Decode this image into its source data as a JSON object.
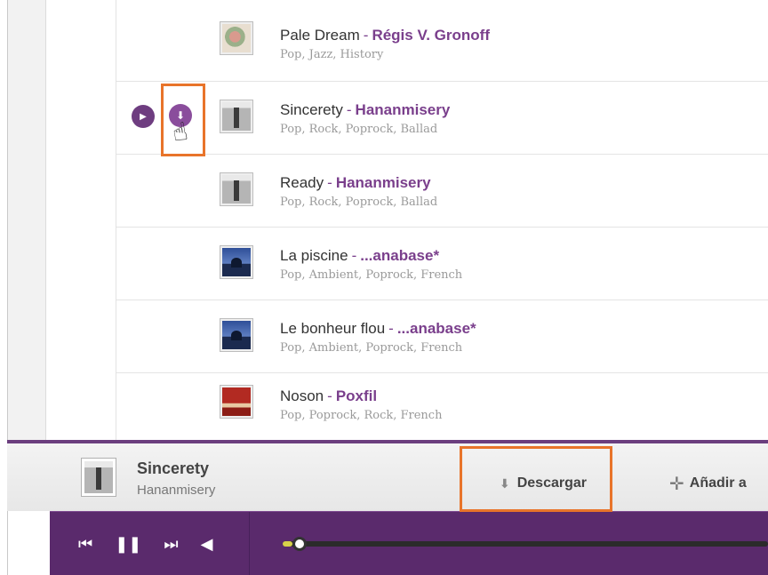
{
  "tracks": [
    {
      "title": "Pale Dream",
      "sep": "-",
      "artist": "Régis V. Gronoff",
      "tags": "Pop, Jazz, History",
      "cover_icon": "flower-cover"
    },
    {
      "title": "Sincerety",
      "sep": "-",
      "artist": "Hananmisery",
      "tags": "Pop, Rock, Poprock, Ballad",
      "cover_icon": "tower-cover"
    },
    {
      "title": "Ready",
      "sep": "-",
      "artist": "Hananmisery",
      "tags": "Pop, Rock, Poprock, Ballad",
      "cover_icon": "tower-cover"
    },
    {
      "title": "La piscine",
      "sep": "-",
      "artist": "...anabase*",
      "tags": "Pop, Ambient, Poprock, French",
      "cover_icon": "night-cover"
    },
    {
      "title": "Le bonheur flou",
      "sep": "-",
      "artist": "...anabase*",
      "tags": "Pop, Ambient, Poprock, French",
      "cover_icon": "night-cover"
    },
    {
      "title": "Noson",
      "sep": "-",
      "artist": "Poxfil",
      "tags": "Pop, Poprock, Rock, French",
      "cover_icon": "red-cover"
    }
  ],
  "row_actions": {
    "play_glyph": "▶",
    "download_glyph": "⬇",
    "cursor_glyph": "☝"
  },
  "now_playing": {
    "title": "Sincerety",
    "artist": "Hananmisery"
  },
  "actions": {
    "download_label": "Descargar",
    "download_glyph": "⬇",
    "add_label": "Añadir a",
    "add_glyph": "✛"
  },
  "player": {
    "prev": "⏮",
    "pause": "❚❚",
    "next": "⏭",
    "volume": "◀",
    "progress": 0.02
  },
  "colors": {
    "accent": "#7a3f8c",
    "player_bg": "#5a2a6c",
    "highlight": "#e8742a"
  }
}
